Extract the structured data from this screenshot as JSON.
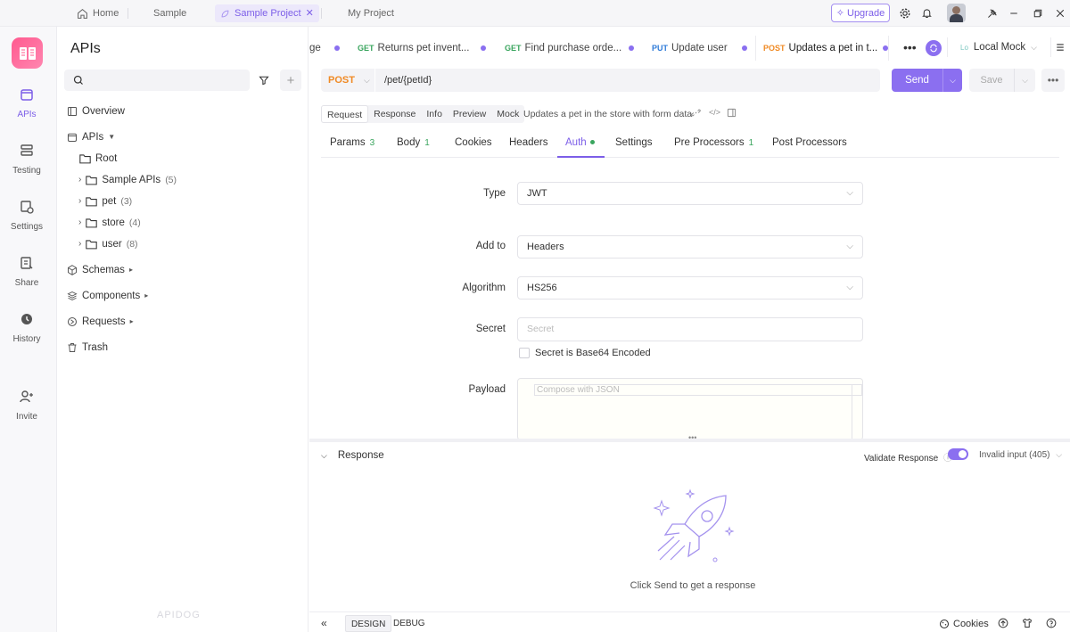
{
  "topbar": {
    "tabs": [
      {
        "label": "Home"
      },
      {
        "label": "Sample"
      },
      {
        "label": "Sample Project"
      },
      {
        "label": "My Project"
      }
    ],
    "upgrade_label": "Upgrade"
  },
  "rail": {
    "items": [
      {
        "label": "APIs"
      },
      {
        "label": "Testing"
      },
      {
        "label": "Settings"
      },
      {
        "label": "Share"
      },
      {
        "label": "History"
      },
      {
        "label": "Invite"
      }
    ]
  },
  "sidebar": {
    "title": "APIs",
    "search_placeholder": "",
    "tree": [
      {
        "label": "Overview",
        "count": ""
      },
      {
        "label": "APIs",
        "count": ""
      },
      {
        "label": "Root",
        "count": ""
      },
      {
        "label": "Sample APIs",
        "count": "(5)"
      },
      {
        "label": "pet",
        "count": "(3)"
      },
      {
        "label": "store",
        "count": "(4)"
      },
      {
        "label": "user",
        "count": "(8)"
      },
      {
        "label": "Schemas",
        "count": ""
      },
      {
        "label": "Components",
        "count": ""
      },
      {
        "label": "Requests",
        "count": ""
      },
      {
        "label": "Trash",
        "count": ""
      }
    ],
    "watermark": "APIDOG"
  },
  "request_tabs": [
    {
      "method": "",
      "label": "ge"
    },
    {
      "method": "GET",
      "label": "Returns pet invent..."
    },
    {
      "method": "GET",
      "label": "Find purchase orde..."
    },
    {
      "method": "PUT",
      "label": "Update user"
    },
    {
      "method": "POST",
      "label": "Updates a pet in t..."
    }
  ],
  "environment": "Local Mock",
  "request": {
    "method": "POST",
    "url": "/pet/{petId}",
    "send_label": "Send",
    "save_label": "Save"
  },
  "subtabs": [
    "Request",
    "Response",
    "Info",
    "Preview",
    "Mock"
  ],
  "description": "Updates a pet in the store with form data",
  "param_tabs": [
    {
      "label": "Params",
      "count": "3"
    },
    {
      "label": "Body",
      "count": "1"
    },
    {
      "label": "Cookies",
      "count": ""
    },
    {
      "label": "Headers",
      "count": ""
    },
    {
      "label": "Auth",
      "count": ""
    },
    {
      "label": "Settings",
      "count": ""
    },
    {
      "label": "Pre Processors",
      "count": "1"
    },
    {
      "label": "Post Processors",
      "count": ""
    }
  ],
  "auth": {
    "type_label": "Type",
    "type_value": "JWT",
    "addto_label": "Add to",
    "addto_value": "Headers",
    "algorithm_label": "Algorithm",
    "algorithm_value": "HS256",
    "secret_label": "Secret",
    "secret_placeholder": "Secret",
    "base64_label": "Secret is Base64 Encoded",
    "payload_label": "Payload",
    "payload_placeholder": "Compose with JSON"
  },
  "response": {
    "title": "Response",
    "validate_label": "Validate Response",
    "validate_on": true,
    "status_select": "Invalid input (405)",
    "hint": "Click Send to get a response"
  },
  "bottombar": {
    "design_label": "DESIGN",
    "debug_label": "DEBUG",
    "cookies_label": "Cookies"
  },
  "colors": {
    "accent": "#7c5ee8",
    "post": "#f08a24",
    "get": "#3aa55e",
    "put": "#2f7bd8"
  }
}
